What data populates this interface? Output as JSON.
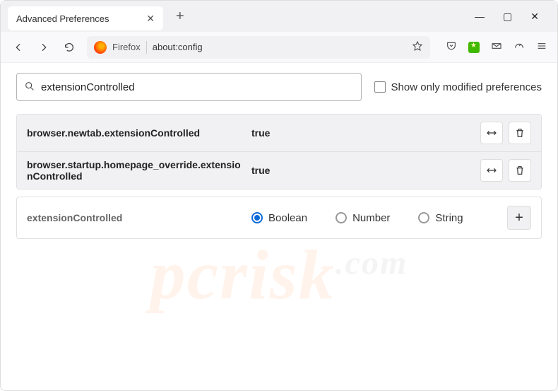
{
  "window": {
    "tab_title": "Advanced Preferences",
    "browser_label": "Firefox",
    "url": "about:config"
  },
  "search": {
    "value": "extensionControlled",
    "checkbox_label": "Show only modified preferences"
  },
  "prefs": [
    {
      "name": "browser.newtab.extensionControlled",
      "value": "true"
    },
    {
      "name": "browser.startup.homepage_override.extensionControlled",
      "value": "true"
    }
  ],
  "add_row": {
    "name": "extensionControlled",
    "types": [
      "Boolean",
      "Number",
      "String"
    ],
    "selected_type": 0
  },
  "watermark": {
    "main": "pcrisk",
    "tld": ".com"
  }
}
